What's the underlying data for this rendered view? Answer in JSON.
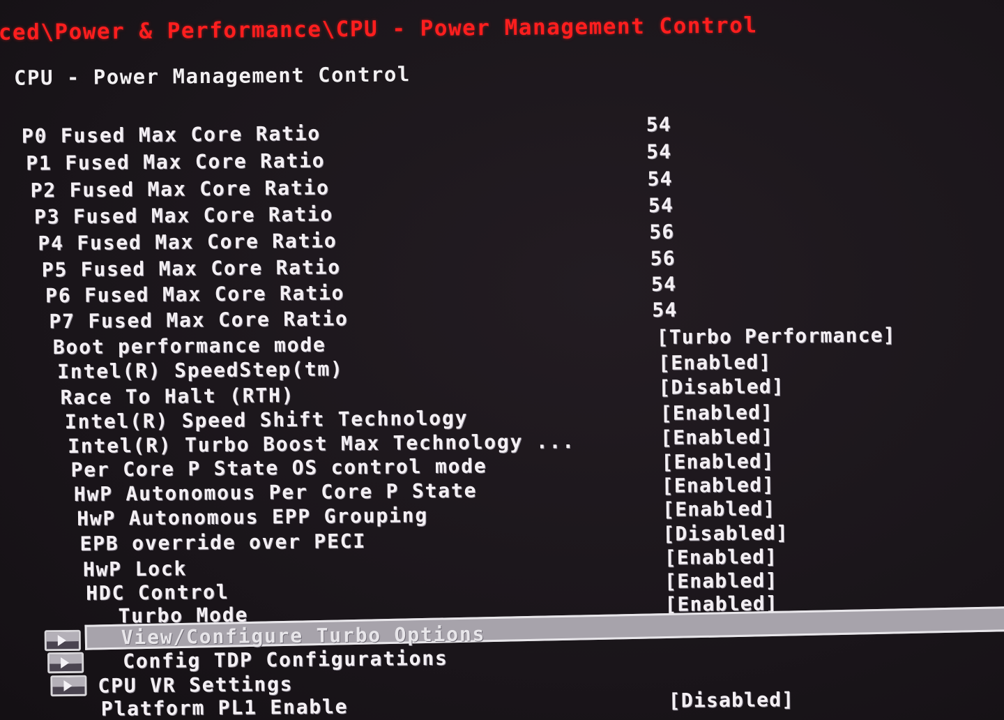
{
  "header": {
    "breadcrumb": "Advanced\\Power & Performance\\CPU - Power Management Control",
    "breadcrumb_visible": "anced\\Power & Performance\\CPU - Power Management Control",
    "breadcrumb_color": "#ff1e1e"
  },
  "page": {
    "title": "CPU - Power Management Control"
  },
  "fused_ratios": [
    {
      "label": "P0 Fused Max Core Ratio",
      "value": "54"
    },
    {
      "label": "P1 Fused Max Core Ratio",
      "value": "54"
    },
    {
      "label": "P2 Fused Max Core Ratio",
      "value": "54"
    },
    {
      "label": "P3 Fused Max Core Ratio",
      "value": "54"
    },
    {
      "label": "P4 Fused Max Core Ratio",
      "value": "56"
    },
    {
      "label": "P5 Fused Max Core Ratio",
      "value": "56"
    },
    {
      "label": "P6 Fused Max Core Ratio",
      "value": "54"
    },
    {
      "label": "P7 Fused Max Core Ratio",
      "value": "54"
    }
  ],
  "settings": [
    {
      "label": "Boot performance mode",
      "value": "[Turbo Performance]"
    },
    {
      "label": "Intel(R) SpeedStep(tm)",
      "value": "[Enabled]"
    },
    {
      "label": "Race To Halt (RTH)",
      "value": "[Disabled]"
    },
    {
      "label": "Intel(R) Speed Shift Technology",
      "value": "[Enabled]"
    },
    {
      "label": "Intel(R) Turbo Boost Max Technology ...",
      "value": "[Enabled]"
    },
    {
      "label": "Per Core P State OS control mode",
      "value": "[Enabled]"
    },
    {
      "label": "HwP Autonomous Per Core P State",
      "value": "[Enabled]"
    },
    {
      "label": "HwP Autonomous EPP Grouping",
      "value": "[Enabled]"
    },
    {
      "label": "EPB override over PECI",
      "value": "[Disabled]"
    },
    {
      "label": "HwP Lock",
      "value": "[Enabled]"
    },
    {
      "label": "HDC Control",
      "value": "[Enabled]"
    },
    {
      "label": "Turbo Mode",
      "value": "[Enabled]"
    }
  ],
  "submenus": [
    {
      "label": "View/Configure Turbo Options",
      "selected": true
    },
    {
      "label": "Config TDP Configurations",
      "selected": false
    },
    {
      "label": "CPU VR Settings",
      "selected": false
    }
  ],
  "trailing_settings": [
    {
      "label": "Platform PL1 Enable",
      "value": "[Disabled]"
    }
  ],
  "colors": {
    "background": "#1c171c",
    "text": "#f4f0f4",
    "highlight": "#a7a3ab",
    "breadcrumb": "#ff1e1e"
  }
}
